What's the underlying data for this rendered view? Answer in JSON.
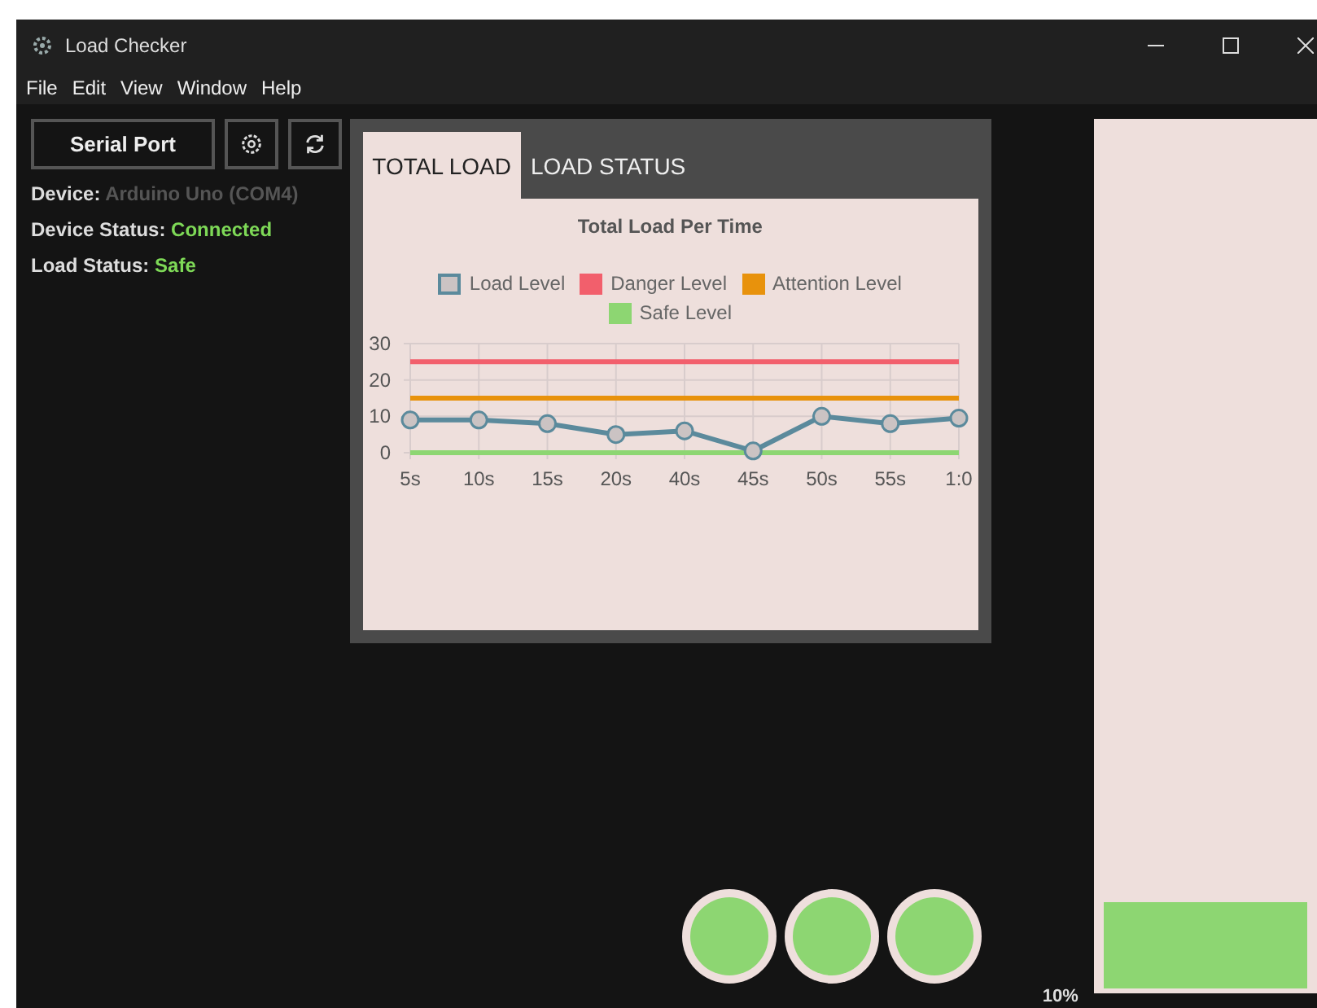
{
  "window": {
    "title": "Load Checker"
  },
  "menu": [
    "File",
    "Edit",
    "View",
    "Window",
    "Help"
  ],
  "sidebar": {
    "serial_button": "Serial Port",
    "device_label": "Device:",
    "device_value": "Arduino Uno (COM4)",
    "device_status_label": "Device Status:",
    "device_status_value": "Connected",
    "load_status_label": "Load Status:",
    "load_status_value": "Safe"
  },
  "tabs": [
    {
      "label": "TOTAL LOAD",
      "selected": true
    },
    {
      "label": "LOAD STATUS",
      "selected": false
    }
  ],
  "chart_data": {
    "type": "line",
    "title": "Total Load Per Time",
    "categories": [
      "5s",
      "10s",
      "15s",
      "20s",
      "40s",
      "45s",
      "50s",
      "55s",
      "1:0"
    ],
    "ylim": [
      0,
      30
    ],
    "grid": true,
    "yticks": [
      0,
      10,
      20,
      30
    ],
    "series": [
      {
        "name": "Load Level",
        "color": "#5b8a9c",
        "marker": true,
        "values": [
          9,
          9,
          8,
          5,
          6,
          0.5,
          10,
          8,
          9.5
        ]
      },
      {
        "name": "Danger Level",
        "color": "#f25f6c",
        "marker": false,
        "values": [
          25,
          25,
          25,
          25,
          25,
          25,
          25,
          25,
          25
        ]
      },
      {
        "name": "Attention Level",
        "color": "#e8920c",
        "marker": false,
        "values": [
          15,
          15,
          15,
          15,
          15,
          15,
          15,
          15,
          15
        ]
      },
      {
        "name": "Safe Level",
        "color": "#8dd672",
        "marker": false,
        "values": [
          0,
          0,
          0,
          0,
          0,
          0,
          0,
          0,
          0
        ]
      }
    ]
  },
  "lights": [
    {
      "color": "#8dd672"
    },
    {
      "color": "#8dd672"
    },
    {
      "color": "#8dd672"
    }
  ],
  "meter": {
    "reading": "10%",
    "level": 0.1
  }
}
